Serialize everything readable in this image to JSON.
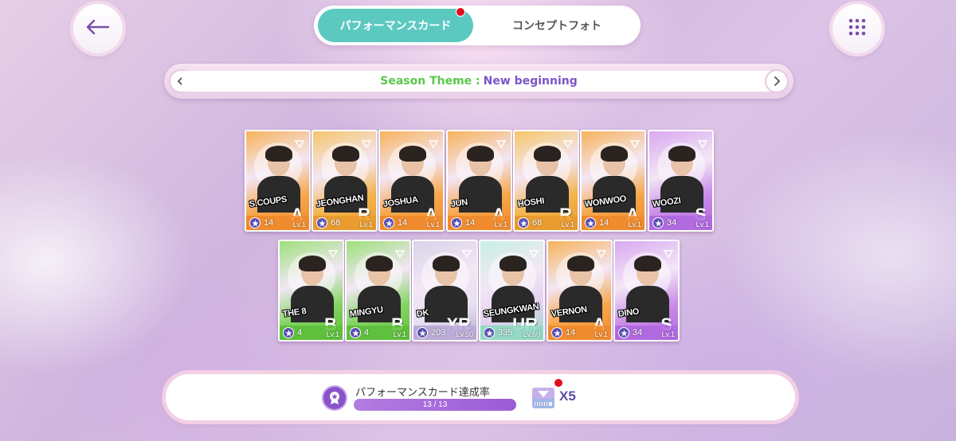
{
  "nav": {
    "back_icon": "arrow-left-icon",
    "menu_icon": "grid-dots-icon"
  },
  "tabs": [
    {
      "label": "パフォーマンスカード",
      "active": true,
      "badge": true
    },
    {
      "label": "コンセプトフォト",
      "active": false,
      "badge": false
    }
  ],
  "season": {
    "prefix": "Season Theme : ",
    "name": "New beginning",
    "prefix_color": "#5ac84a",
    "name_color": "#7a55c8"
  },
  "cards": [
    {
      "name": "S.COUPS",
      "rank": "A",
      "stars": "14",
      "level": "Lv.1",
      "color": "orange"
    },
    {
      "name": "JEONGHAN",
      "rank": "R",
      "stars": "68",
      "level": "Lv.1",
      "color": "amber"
    },
    {
      "name": "JOSHUA",
      "rank": "A",
      "stars": "14",
      "level": "Lv.1",
      "color": "orange"
    },
    {
      "name": "JUN",
      "rank": "A",
      "stars": "14",
      "level": "Lv.1",
      "color": "orange"
    },
    {
      "name": "HOSHI",
      "rank": "R",
      "stars": "68",
      "level": "Lv.1",
      "color": "amber"
    },
    {
      "name": "WONWOO",
      "rank": "A",
      "stars": "14",
      "level": "Lv.1",
      "color": "orange"
    },
    {
      "name": "WOOZI",
      "rank": "S",
      "stars": "34",
      "level": "Lv.1",
      "color": "purple"
    },
    {
      "name": "THE 8",
      "rank": "B",
      "stars": "4",
      "level": "Lv.1",
      "color": "green"
    },
    {
      "name": "MINGYU",
      "rank": "B",
      "stars": "4",
      "level": "Lv.1",
      "color": "green"
    },
    {
      "name": "DK",
      "rank": "XR",
      "stars": "203",
      "level": "Lv.50",
      "color": "silver"
    },
    {
      "name": "SEUNGKWAN",
      "rank": "UR",
      "stars": "335",
      "level": "Lv.60",
      "color": "mint"
    },
    {
      "name": "VERNON",
      "rank": "A",
      "stars": "14",
      "level": "Lv.1",
      "color": "orange"
    },
    {
      "name": "DINO",
      "rank": "S",
      "stars": "34",
      "level": "Lv.1",
      "color": "purple"
    }
  ],
  "completion": {
    "label": "パフォーマンスカード達成率",
    "progress_text": "13 / 13",
    "fraction": 1.0,
    "ticket_count": "X5",
    "ticket_badge": true
  },
  "colors": {
    "accent_teal": "#5cc9c1",
    "badge_red": "#e01020",
    "purple": "#8a52c9"
  }
}
